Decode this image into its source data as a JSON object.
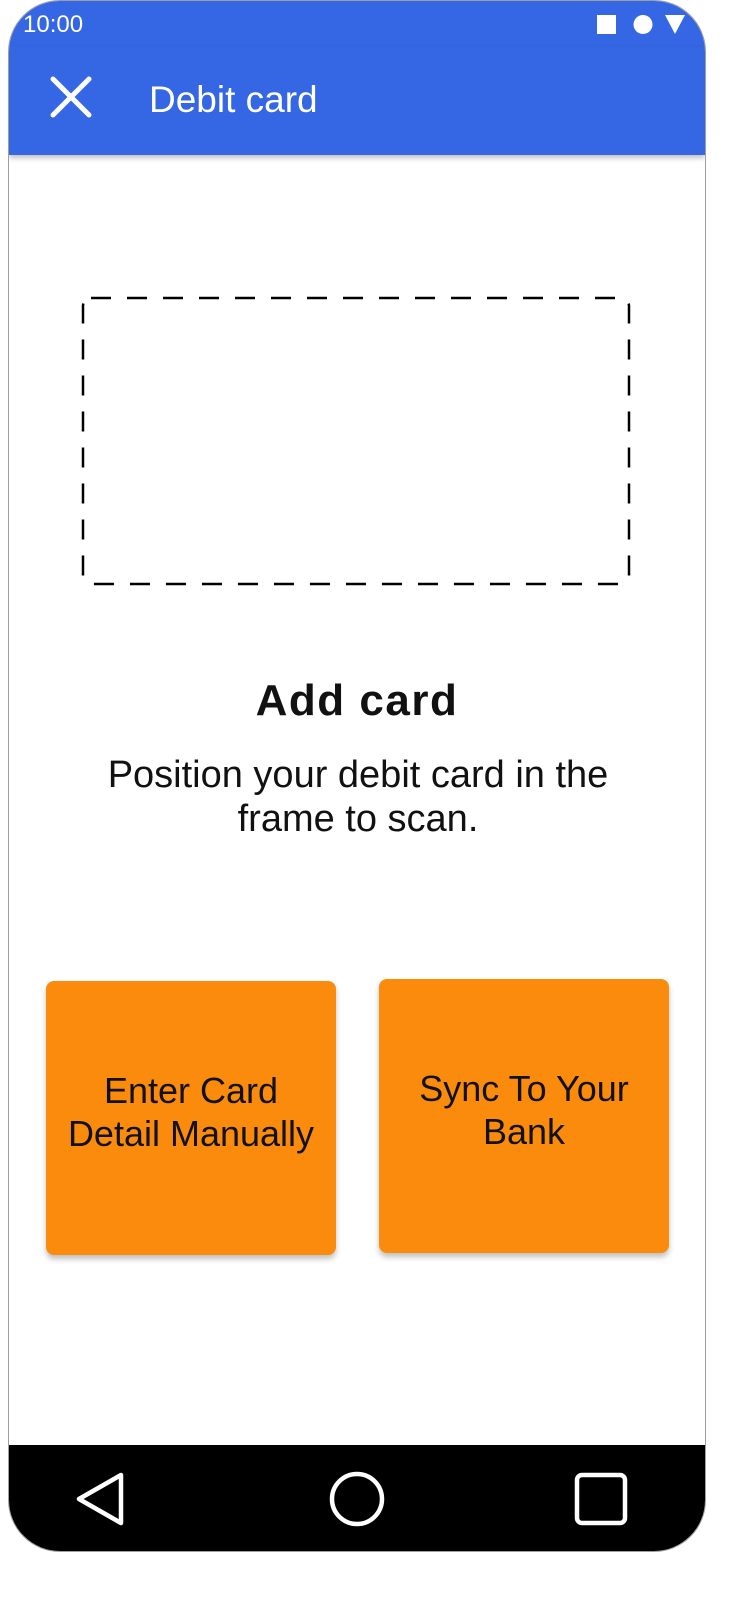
{
  "status_bar": {
    "time": "10:00",
    "icons": [
      "square-icon",
      "circle-icon",
      "triangle-icon"
    ]
  },
  "app_bar": {
    "title": "Debit card",
    "close_icon": "close-icon"
  },
  "scan": {
    "heading": "Add card",
    "instruction": "Position your debit card in the frame to scan."
  },
  "actions": {
    "manual_label": "Enter Card Detail Manually",
    "sync_label": "Sync To Your Bank"
  },
  "nav_bar": {
    "icons": [
      "back-icon",
      "home-icon",
      "recent-apps-icon"
    ]
  },
  "colors": {
    "primary": "#3566e3",
    "accent": "#fb8b0d",
    "nav_background": "#000000"
  }
}
